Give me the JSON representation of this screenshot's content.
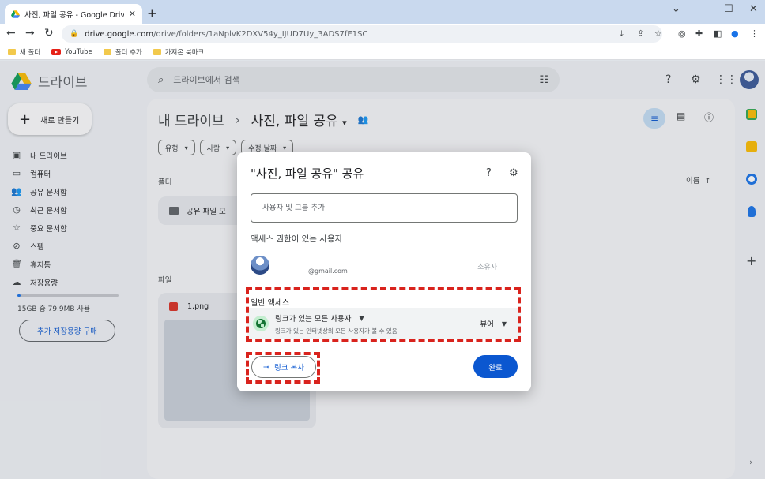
{
  "browser": {
    "tab_title": "사진, 파일 공유 - Google Drive",
    "tab_close": "✕",
    "new_tab": "+",
    "window_controls": [
      "⌄",
      "—",
      "☐",
      "✕"
    ],
    "url_domain": "drive.google.com",
    "url_path": "/drive/folders/1aNplvK2DXV54y_IJUD7Uy_3ADS7fE1SC",
    "bookmarks": [
      {
        "label": "새 폴더",
        "icon": "folder-icon"
      },
      {
        "label": "YouTube",
        "icon": "youtube-icon"
      },
      {
        "label": "폴더 추가",
        "icon": "folder-icon"
      },
      {
        "label": "가져온 북마크",
        "icon": "folder-icon"
      }
    ]
  },
  "drive": {
    "logo_text": "드라이브",
    "search_placeholder": "드라이브에서 검색",
    "new_label": "새로 만들기",
    "nav": [
      {
        "label": "내 드라이브",
        "icon": "drive-icon",
        "glyph": "▣"
      },
      {
        "label": "컴퓨터",
        "icon": "computer-icon",
        "glyph": "▭"
      },
      {
        "label": "공유 문서함",
        "icon": "shared-icon",
        "glyph": "👥"
      },
      {
        "label": "최근 문서함",
        "icon": "clock-icon",
        "glyph": "◷"
      },
      {
        "label": "중요 문서함",
        "icon": "star-icon",
        "glyph": "☆"
      },
      {
        "label": "스팸",
        "icon": "spam-icon",
        "glyph": "⊘"
      },
      {
        "label": "휴지통",
        "icon": "trash-icon",
        "glyph": "🗑"
      },
      {
        "label": "저장용량",
        "icon": "cloud-icon",
        "glyph": "☁"
      }
    ],
    "storage_text": "15GB 중 79.9MB 사용",
    "storage_fraction": 0.03,
    "buy_storage": "추가 저장용량 구매",
    "breadcrumb_root": "내 드라이브",
    "breadcrumb_sep": "›",
    "breadcrumb_current": "사진, 파일 공유",
    "breadcrumb_caret": "▾",
    "chips": [
      "유형",
      "사람",
      "수정 날짜"
    ],
    "folders_label": "폴더",
    "folder_name": "공유 파일 모",
    "files_label": "파일",
    "file_name": "1.png",
    "sort_label": "이름",
    "sort_arrow": "↑"
  },
  "dialog": {
    "title": "\"사진, 파일 공유\" 공유",
    "add_placeholder": "사용자 및 그룹 추가",
    "access_header": "액세스 권한이 있는 사용자",
    "user_email": "@gmail.com",
    "user_role": "소유자",
    "general_access_label": "일반 액세스",
    "link_access": "링크가 있는 모든 사용자",
    "link_access_desc": "링크가 있는 인터넷상의 모든 사용자가 볼 수 있음",
    "link_role": "뷰어",
    "copy_link": "링크 복사",
    "done": "완료"
  },
  "colors": {
    "accent": "#0b57d0",
    "highlight": "#d9231d",
    "globe_bg": "#c4eed0"
  }
}
